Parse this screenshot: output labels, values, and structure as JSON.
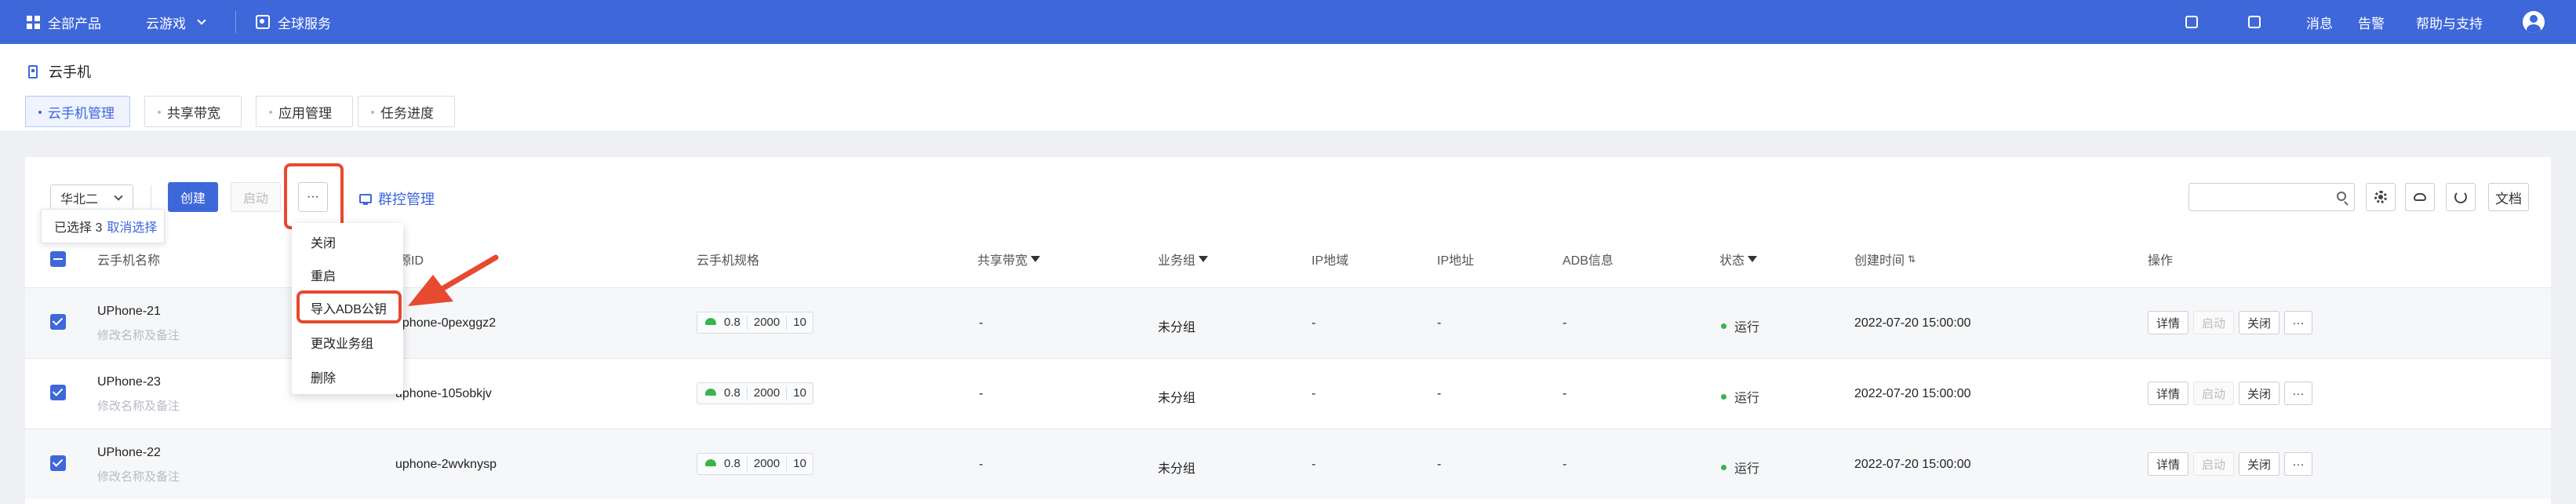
{
  "topbar": {
    "all_products": "全部产品",
    "product": "云游戏",
    "global": "全球服务",
    "messages": "消息",
    "alerts": "告警",
    "help": "帮助与支持"
  },
  "page": {
    "title": "云手机",
    "tabs": [
      "云手机管理",
      "共享带宽",
      "应用管理",
      "任务进度"
    ]
  },
  "toolbar": {
    "region": "华北二",
    "create": "创建",
    "start": "启动",
    "more": "···",
    "group_control": "群控管理",
    "search_placeholder": "",
    "doc": "文档"
  },
  "selection": {
    "text": "已选择 3",
    "cancel": "取消选择"
  },
  "dropdown": {
    "items": [
      "关闭",
      "重启",
      "导入ADB公钥",
      "更改业务组",
      "删除"
    ]
  },
  "table": {
    "headers": [
      "云手机名称",
      "资源ID",
      "云手机规格",
      "共享带宽",
      "业务组",
      "IP地域",
      "IP地址",
      "ADB信息",
      "状态",
      "创建时间",
      "操作"
    ],
    "rows": [
      {
        "name": "UPhone-21",
        "note": "修改名称及备注",
        "id": "uphone-0pexggz2",
        "cpu": "0.8",
        "mem": "2000",
        "disk": "10",
        "bandwidth": "-",
        "group": "未分组",
        "ip_region": "-",
        "ip": "-",
        "adb": "-",
        "status": "运行",
        "created": "2022-07-20 15:00:00"
      },
      {
        "name": "UPhone-23",
        "note": "修改名称及备注",
        "id": "uphone-105obkjv",
        "cpu": "0.8",
        "mem": "2000",
        "disk": "10",
        "bandwidth": "-",
        "group": "未分组",
        "ip_region": "-",
        "ip": "-",
        "adb": "-",
        "status": "运行",
        "created": "2022-07-20 15:00:00"
      },
      {
        "name": "UPhone-22",
        "note": "修改名称及备注",
        "id": "uphone-2wvknysp",
        "cpu": "0.8",
        "mem": "2000",
        "disk": "10",
        "bandwidth": "-",
        "group": "未分组",
        "ip_region": "-",
        "ip": "-",
        "adb": "-",
        "status": "运行",
        "created": "2022-07-20 15:00:00"
      }
    ],
    "actions": {
      "detail": "详情",
      "start": "启动",
      "close": "关闭",
      "more": "···"
    }
  },
  "colors": {
    "accent": "#3e67d9",
    "highlight": "#e64a2f",
    "running": "#39b54a"
  }
}
